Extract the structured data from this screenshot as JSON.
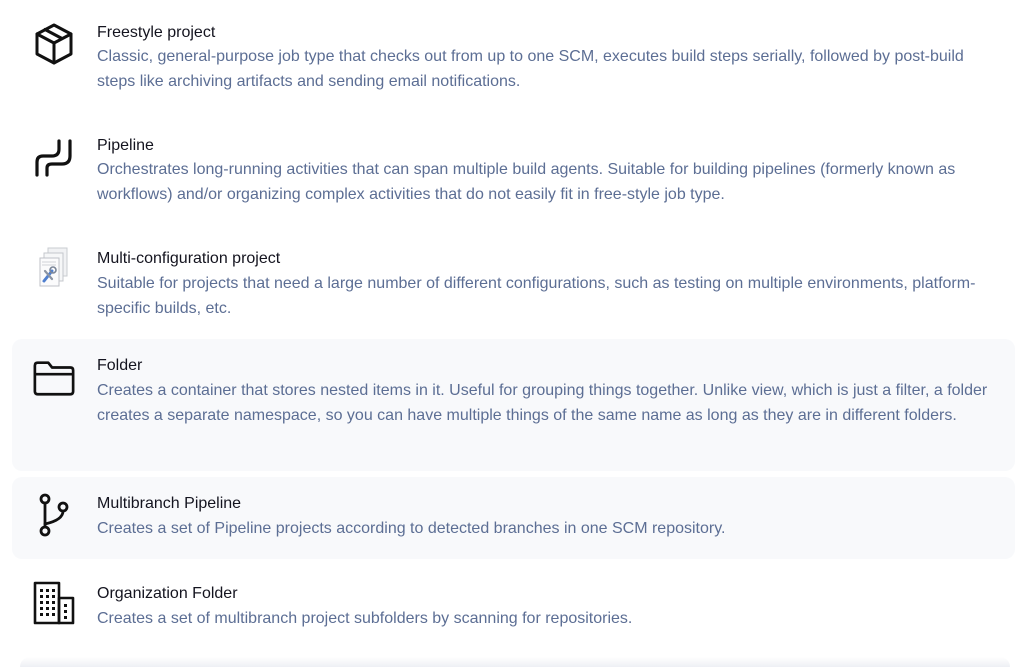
{
  "items": [
    {
      "title": "Freestyle project",
      "description": "Classic, general-purpose job type that checks out from up to one SCM, executes build steps serially, followed by post-build steps like archiving artifacts and sending email notifications.",
      "icon": "cube-icon"
    },
    {
      "title": "Pipeline",
      "description": "Orchestrates long-running activities that can span multiple build agents. Suitable for building pipelines (formerly known as workflows) and/or organizing complex activities that do not easily fit in free-style job type.",
      "icon": "pipeline-icon"
    },
    {
      "title": "Multi-configuration project",
      "description": "Suitable for projects that need a large number of different configurations, such as testing on multiple environments, platform-specific builds, etc.",
      "icon": "multi-config-icon"
    },
    {
      "title": "Folder",
      "description": "Creates a container that stores nested items in it. Useful for grouping things together. Unlike view, which is just a filter, a folder creates a separate namespace, so you can have multiple things of the same name as long as they are in different folders.",
      "icon": "folder-icon"
    },
    {
      "title": "Multibranch Pipeline",
      "description": "Creates a set of Pipeline projects according to detected branches in one SCM repository.",
      "icon": "branch-icon"
    },
    {
      "title": "Organization Folder",
      "description": "Creates a set of multibranch project subfolders by scanning for repositories.",
      "icon": "building-icon"
    }
  ],
  "colors": {
    "title": "#14141f",
    "description": "#5c6e94",
    "hover_background": "#f8f9fb"
  }
}
